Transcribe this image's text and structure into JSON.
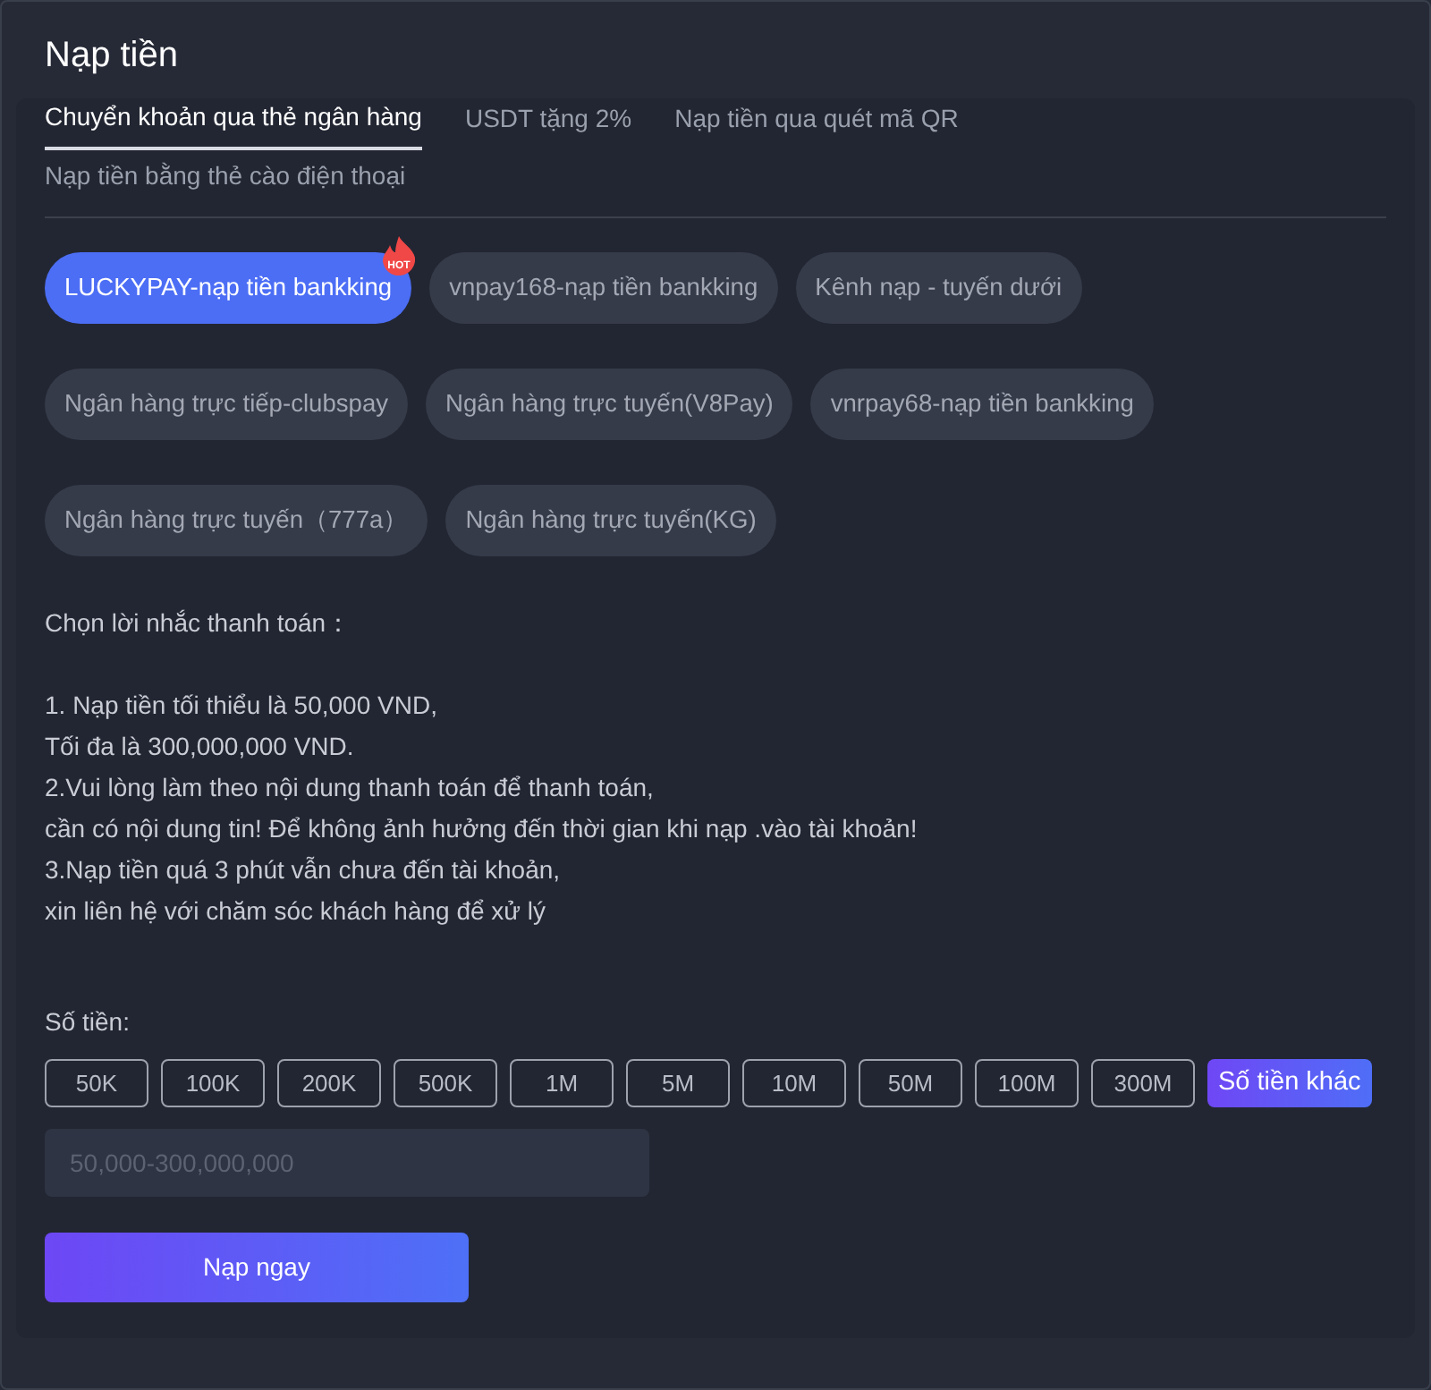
{
  "title": "Nạp tiền",
  "tabs": [
    {
      "label": "Chuyển khoản qua thẻ ngân hàng",
      "selected": true
    },
    {
      "label": "USDT tặng 2%",
      "selected": false
    },
    {
      "label": "Nạp tiền qua quét mã QR",
      "selected": false
    },
    {
      "label": "Nạp tiền bằng thẻ cào điện thoại",
      "selected": false
    }
  ],
  "channels": [
    {
      "label": "LUCKYPAY-nạp tiền bankking",
      "selected": true,
      "badge": "HOT"
    },
    {
      "label": "vnpay168-nạp tiền bankking",
      "selected": false
    },
    {
      "label": "Kênh nạp - tuyến dưới",
      "selected": false
    },
    {
      "label": "Ngân hàng trực tiếp-clubspay",
      "selected": false
    },
    {
      "label": "Ngân hàng trực tuyến(V8Pay)",
      "selected": false
    },
    {
      "label": "vnrpay68-nạp tiền bankking",
      "selected": false
    },
    {
      "label": "Ngân hàng trực tuyến（777a）",
      "selected": false
    },
    {
      "label": "Ngân hàng trực tuyến(KG)",
      "selected": false
    }
  ],
  "notice": {
    "heading": "Chọn lời nhắc thanh toán：",
    "lines": [
      "1. Nạp tiền tối thiểu là 50,000 VND,",
      "Tối đa là 300,000,000 VND.",
      "2.Vui lòng làm theo nội dung thanh toán để thanh toán,",
      "cần có nội dung tin! Để không ảnh hưởng đến thời gian khi nạp .vào tài khoản!",
      "3.Nạp tiền quá 3 phút vẫn chưa đến tài khoản,",
      "xin liên hệ với chăm sóc khách hàng để xử lý"
    ]
  },
  "amount": {
    "label": "Số tiền:",
    "options": [
      {
        "label": "50K",
        "selected": false
      },
      {
        "label": "100K",
        "selected": false
      },
      {
        "label": "200K",
        "selected": false
      },
      {
        "label": "500K",
        "selected": false
      },
      {
        "label": "1M",
        "selected": false
      },
      {
        "label": "5M",
        "selected": false
      },
      {
        "label": "10M",
        "selected": false
      },
      {
        "label": "50M",
        "selected": false
      },
      {
        "label": "100M",
        "selected": false
      },
      {
        "label": "300M",
        "selected": false
      },
      {
        "label": "Số tiền khác",
        "selected": true
      }
    ],
    "placeholder": "50,000-300,000,000"
  },
  "submit": "Nạp ngay"
}
